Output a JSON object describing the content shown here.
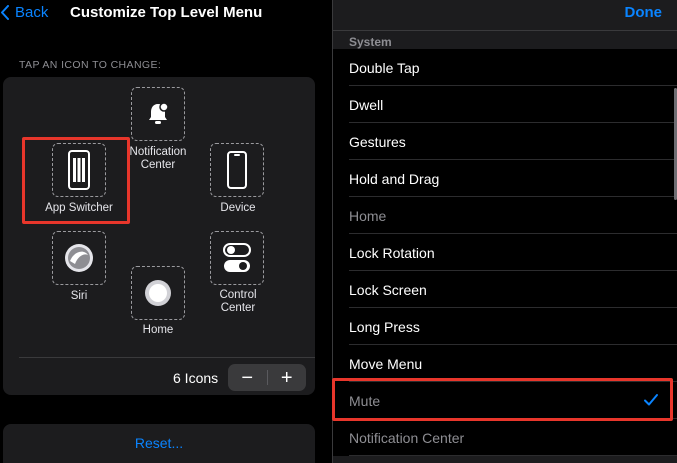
{
  "left_panel": {
    "back_label": "Back",
    "title": "Customize Top Level Menu",
    "section_caption": "TAP AN ICON TO CHANGE:",
    "slots": [
      {
        "id": "notification-center",
        "label": "Notification\nCenter",
        "icon": "bell-icon"
      },
      {
        "id": "app-switcher",
        "label": "App Switcher",
        "icon": "app-switcher-icon"
      },
      {
        "id": "device",
        "label": "Device",
        "icon": "device-icon"
      },
      {
        "id": "siri",
        "label": "Siri",
        "icon": "siri-icon"
      },
      {
        "id": "control-center",
        "label": "Control\nCenter",
        "icon": "toggles-icon"
      },
      {
        "id": "home",
        "label": "Home",
        "icon": "home-button-icon"
      }
    ],
    "icons_count_label": "6 Icons",
    "stepper": {
      "minus": "−",
      "plus": "+"
    },
    "reset_label": "Reset..."
  },
  "right_panel": {
    "done_label": "Done",
    "group_header": "System",
    "items": [
      {
        "label": "Double Tap",
        "enabled": true,
        "selected": false
      },
      {
        "label": "Dwell",
        "enabled": true,
        "selected": false
      },
      {
        "label": "Gestures",
        "enabled": true,
        "selected": false
      },
      {
        "label": "Hold and Drag",
        "enabled": true,
        "selected": false
      },
      {
        "label": "Home",
        "enabled": false,
        "selected": false
      },
      {
        "label": "Lock Rotation",
        "enabled": true,
        "selected": false
      },
      {
        "label": "Lock Screen",
        "enabled": true,
        "selected": false
      },
      {
        "label": "Long Press",
        "enabled": true,
        "selected": false
      },
      {
        "label": "Move Menu",
        "enabled": true,
        "selected": false
      },
      {
        "label": "Mute",
        "enabled": false,
        "selected": true
      },
      {
        "label": "Notification Center",
        "enabled": false,
        "selected": false
      }
    ]
  },
  "colors": {
    "accent": "#0a84ff",
    "highlight": "#e8362b",
    "background": "#000000",
    "card": "#1c1c1e"
  }
}
